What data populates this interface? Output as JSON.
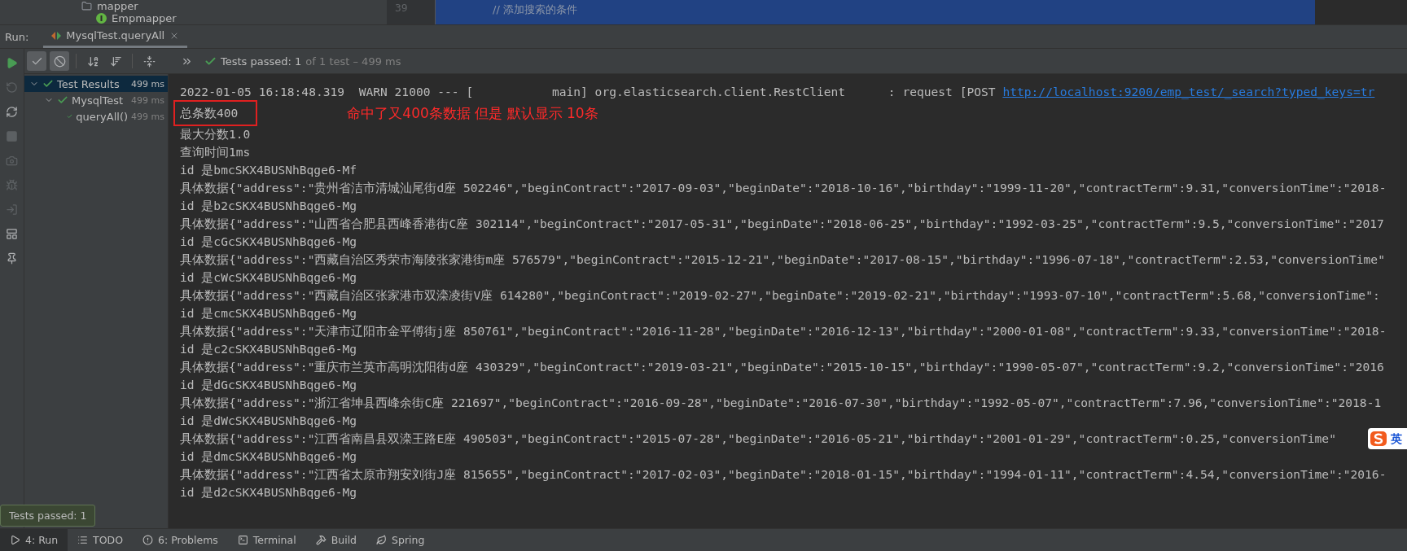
{
  "project_tree": {
    "items": [
      {
        "kind": "folder",
        "label": "mapper"
      },
      {
        "kind": "interface",
        "label": "Empmapper"
      }
    ]
  },
  "editor": {
    "line_number": "39",
    "code": "// 添加搜索的条件"
  },
  "run_bar": {
    "label": "Run:",
    "tabs": [
      {
        "label": "MysqlTest.queryAll",
        "selected": true
      }
    ]
  },
  "side_actions": [
    {
      "kind": "run",
      "disabled": false
    },
    {
      "kind": "rerun-failed",
      "disabled": true
    },
    {
      "kind": "toggle-auto",
      "disabled": false
    },
    {
      "kind": "stop",
      "disabled": true
    },
    {
      "kind": "camera",
      "disabled": true
    },
    {
      "kind": "bug",
      "disabled": true
    },
    {
      "kind": "import",
      "disabled": true
    },
    {
      "kind": "layout",
      "disabled": false
    },
    {
      "kind": "pin",
      "disabled": false
    }
  ],
  "toolbar": {
    "buttons": [
      {
        "kind": "show-passed",
        "selected": true
      },
      {
        "kind": "show-ignored",
        "selected": true
      },
      {
        "kind": "sort-alpha",
        "selected": false
      },
      {
        "kind": "sort-duration",
        "selected": false
      },
      {
        "kind": "collapse",
        "selected": false
      },
      {
        "kind": "more",
        "selected": false
      }
    ],
    "status": {
      "passed": "Tests passed: 1",
      "summary": "of 1 test – 499 ms"
    }
  },
  "test_tree": [
    {
      "label": "Test Results",
      "time": "499 ms",
      "selected": true,
      "expanded": true,
      "children": [
        {
          "label": "MysqlTest",
          "time": "499 ms",
          "selected": false,
          "expanded": true,
          "children": [
            {
              "label": "queryAll()",
              "time": "499 ms",
              "selected": false
            }
          ]
        }
      ]
    }
  ],
  "console": {
    "lines": [
      {
        "kind": "log",
        "text": "2022-01-05 16:18:48.319  WARN 21000 --- [           main] org.elasticsearch.client.RestClient      : request [POST ",
        "link": "http://localhost:9200/emp_test/_search?typed_keys=tr"
      },
      {
        "kind": "highlight",
        "text": "总条数400",
        "note": "命中了又400条数据 但是 默认显示 10条"
      },
      {
        "kind": "plain",
        "text": "最大分数1.0"
      },
      {
        "kind": "plain",
        "text": "查询时间1ms"
      },
      {
        "kind": "plain",
        "text": "id 是bmcSKX4BUSNhBqge6-Mf"
      },
      {
        "kind": "plain",
        "text": "具体数据{\"address\":\"贵州省洁市清城汕尾街d座 502246\",\"beginContract\":\"2017-09-03\",\"beginDate\":\"2018-10-16\",\"birthday\":\"1999-11-20\",\"contractTerm\":9.31,\"conversionTime\":\"2018-"
      },
      {
        "kind": "plain",
        "text": "id 是b2cSKX4BUSNhBqge6-Mg"
      },
      {
        "kind": "plain",
        "text": "具体数据{\"address\":\"山西省合肥县西峰香港街C座 302114\",\"beginContract\":\"2017-05-31\",\"beginDate\":\"2018-06-25\",\"birthday\":\"1992-03-25\",\"contractTerm\":9.5,\"conversionTime\":\"2017"
      },
      {
        "kind": "plain",
        "text": "id 是cGcSKX4BUSNhBqge6-Mg"
      },
      {
        "kind": "plain",
        "text": "具体数据{\"address\":\"西藏自治区秀荣市海陵张家港街m座 576579\",\"beginContract\":\"2015-12-21\",\"beginDate\":\"2017-08-15\",\"birthday\":\"1996-07-18\",\"contractTerm\":2.53,\"conversionTime\""
      },
      {
        "kind": "plain",
        "text": "id 是cWcSKX4BUSNhBqge6-Mg"
      },
      {
        "kind": "plain",
        "text": "具体数据{\"address\":\"西藏自治区张家港市双滦凌街V座 614280\",\"beginContract\":\"2019-02-27\",\"beginDate\":\"2019-02-21\",\"birthday\":\"1993-07-10\",\"contractTerm\":5.68,\"conversionTime\":"
      },
      {
        "kind": "plain",
        "text": "id 是cmcSKX4BUSNhBqge6-Mg"
      },
      {
        "kind": "plain",
        "text": "具体数据{\"address\":\"天津市辽阳市金平傅街j座 850761\",\"beginContract\":\"2016-11-28\",\"beginDate\":\"2016-12-13\",\"birthday\":\"2000-01-08\",\"contractTerm\":9.33,\"conversionTime\":\"2018-"
      },
      {
        "kind": "plain",
        "text": "id 是c2cSKX4BUSNhBqge6-Mg"
      },
      {
        "kind": "plain",
        "text": "具体数据{\"address\":\"重庆市兰英市高明沈阳街d座 430329\",\"beginContract\":\"2019-03-21\",\"beginDate\":\"2015-10-15\",\"birthday\":\"1990-05-07\",\"contractTerm\":9.2,\"conversionTime\":\"2016"
      },
      {
        "kind": "plain",
        "text": "id 是dGcSKX4BUSNhBqge6-Mg"
      },
      {
        "kind": "plain",
        "text": "具体数据{\"address\":\"浙江省坤县西峰余街C座 221697\",\"beginContract\":\"2016-09-28\",\"beginDate\":\"2016-07-30\",\"birthday\":\"1992-05-07\",\"contractTerm\":7.96,\"conversionTime\":\"2018-1"
      },
      {
        "kind": "plain",
        "text": "id 是dWcSKX4BUSNhBqge6-Mg"
      },
      {
        "kind": "plain",
        "text": "具体数据{\"address\":\"江西省南昌县双滦王路E座 490503\",\"beginContract\":\"2015-07-28\",\"beginDate\":\"2016-05-21\",\"birthday\":\"2001-01-29\",\"contractTerm\":0.25,\"conversionTime\"",
        "ime_badge": "英"
      },
      {
        "kind": "plain",
        "text": "id 是dmcSKX4BUSNhBqge6-Mg"
      },
      {
        "kind": "plain",
        "text": "具体数据{\"address\":\"江西省太原市翔安刘街J座 815655\",\"beginContract\":\"2017-02-03\",\"beginDate\":\"2018-01-15\",\"birthday\":\"1994-01-11\",\"contractTerm\":4.54,\"conversionTime\":\"2016-"
      },
      {
        "kind": "plain",
        "text": "id 是d2cSKX4BUSNhBqge6-Mg"
      }
    ]
  },
  "tooltip": "Tests passed: 1",
  "bottom_tabs": [
    {
      "kind": "run",
      "label": "4: Run",
      "selected": true
    },
    {
      "kind": "todo",
      "label": "TODO",
      "selected": false
    },
    {
      "kind": "problems",
      "label": "6: Problems",
      "selected": false
    },
    {
      "kind": "terminal",
      "label": "Terminal",
      "selected": false
    },
    {
      "kind": "build",
      "label": "Build",
      "selected": false
    },
    {
      "kind": "spring",
      "label": "Spring",
      "selected": false
    }
  ]
}
